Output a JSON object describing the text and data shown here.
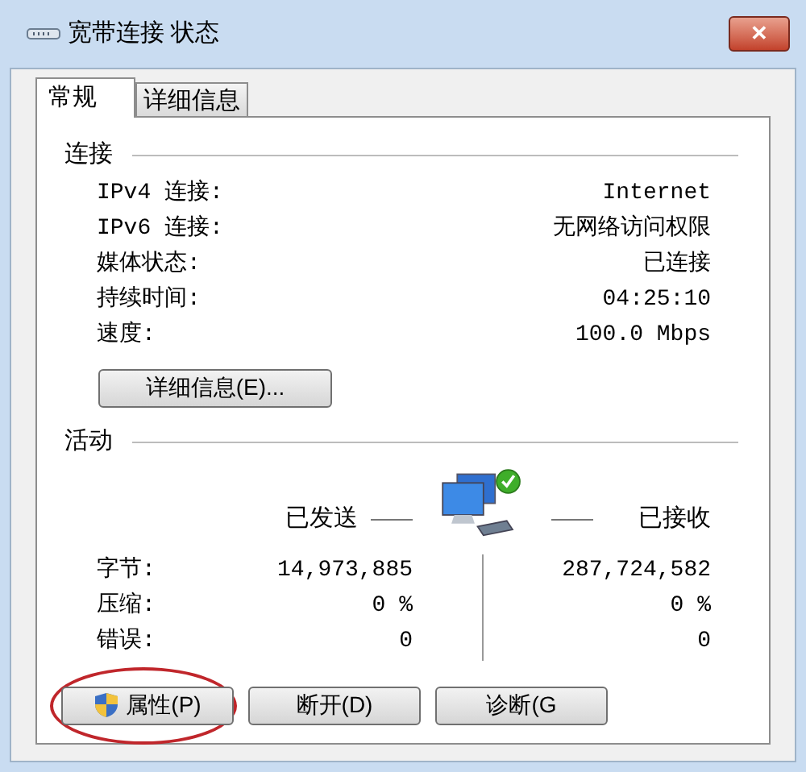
{
  "window": {
    "title": "宽带连接 状态",
    "close": "✕"
  },
  "tabs": [
    {
      "label": "常规",
      "selected": true
    },
    {
      "label": "详细信息",
      "selected": false
    }
  ],
  "connection": {
    "heading": "连接",
    "rows": [
      {
        "label": "IPv4 连接:",
        "value": "Internet"
      },
      {
        "label": "IPv6 连接:",
        "value": "无网络访问权限"
      },
      {
        "label": "媒体状态:",
        "value": "已连接"
      },
      {
        "label": "持续时间:",
        "value": "04:25:10"
      },
      {
        "label": "速度:",
        "value": "100.0 Mbps"
      }
    ],
    "details_button": "详细信息(E)..."
  },
  "activity": {
    "heading": "活动",
    "sent_label": "已发送",
    "received_label": "已接收",
    "rows": [
      {
        "label": "字节:",
        "sent": "14,973,885",
        "received": "287,724,582"
      },
      {
        "label": "压缩:",
        "sent": "0 %",
        "received": "0 %"
      },
      {
        "label": "错误:",
        "sent": "0",
        "received": "0"
      }
    ]
  },
  "buttons": [
    {
      "label": "属性(P)",
      "shield": true,
      "highlighted": true
    },
    {
      "label": "断开(D)",
      "shield": false,
      "highlighted": false
    },
    {
      "label": "诊断(G",
      "shield": false,
      "highlighted": false
    }
  ]
}
